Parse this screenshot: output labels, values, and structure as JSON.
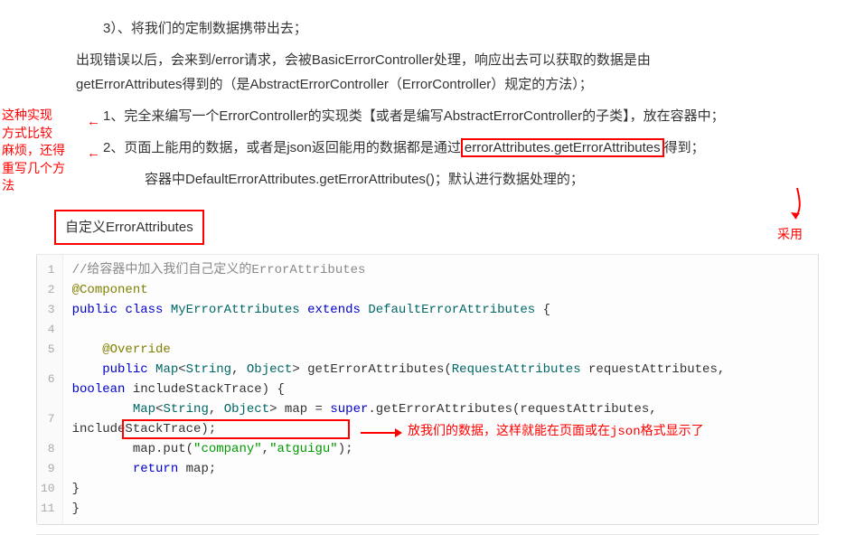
{
  "text": {
    "line1": "3）、将我们的定制数据携带出去；",
    "para1a": "出现错误以后，会来到/error请求，会被BasicErrorController处理，响应出去可以获取的数据是由",
    "para1b": "getErrorAttributes得到的（是AbstractErrorController（ErrorController）规定的方法）；",
    "sideNote": "这种实现\n方式比较\n麻烦，还得\n重写几个方法",
    "num1_part1": "1、完全来编写一个ErrorController的实现类【或者是编写AbstractErrorController的子类】，放在容器中；",
    "num2_prefix": "2、页面上能用的数据，或者是json返回能用的数据都是通过",
    "num2_boxed": "errorAttributes.getErrorAttributes",
    "num2_suffix": "得到；",
    "adopt": "采用",
    "num2_sub": "容器中DefaultErrorAttributes.getErrorAttributes()；默认进行数据处理的；",
    "sectionTitle": "自定义ErrorAttributes"
  },
  "code": {
    "gutter": [
      "1",
      "2",
      "3",
      "4",
      "5",
      "6",
      "7",
      "8",
      "9",
      "10",
      "11"
    ],
    "l1": "//给容器中加入我们自己定义的ErrorAttributes",
    "l2": "@Component",
    "l3_kw1": "public",
    "l3_kw2": "class",
    "l3_cls": "MyErrorAttributes",
    "l3_kw3": "extends",
    "l3_sup": "DefaultErrorAttributes",
    "l3_br": "{",
    "l5": "@Override",
    "l6_kw": "public",
    "l6_map": "Map",
    "l6_gen1": "String",
    "l6_gen2": "Object",
    "l6_mth": "getErrorAttributes",
    "l6_p1t": "RequestAttributes",
    "l6_p1n": "requestAttributes",
    "l6_wrap_kw": "boolean",
    "l6_wrap_n": "includeStackTrace",
    "l7_map": "Map",
    "l7_g1": "String",
    "l7_g2": "Object",
    "l7_var": "map",
    "l7_sup": "super",
    "l7_mth": "getErrorAttributes",
    "l7_a1": "requestAttributes",
    "l7_wrap": "includeStackTrace);",
    "l8": "map.put(\"company\",\"atguigu\");",
    "l8_put": "map.put",
    "l8_s1": "\"company\"",
    "l8_s2": "\"atguigu\"",
    "l9_kw": "return",
    "l9_v": "map;",
    "l10": "    }",
    "l11": "}"
  },
  "annotations": {
    "codeArrowText": "放我们的数据，这样就能在页面或在json格式显示了"
  }
}
